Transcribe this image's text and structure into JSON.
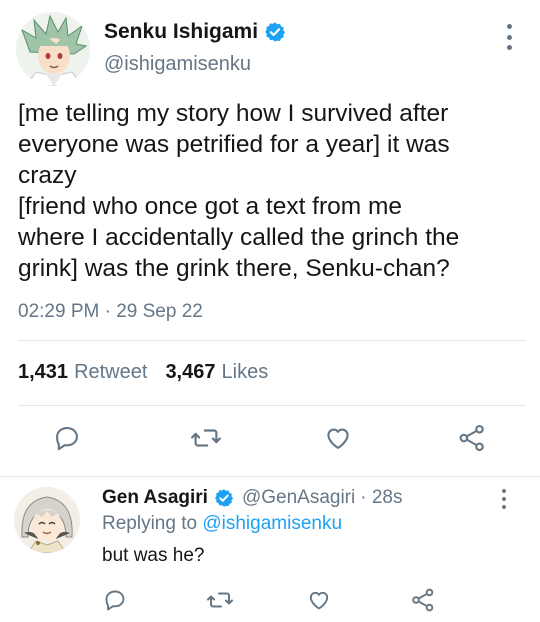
{
  "main_tweet": {
    "author": {
      "display_name": "Senku Ishigami",
      "handle": "@ishigamisenku",
      "verified": true
    },
    "text_lines": [
      "[me telling my story how I survived after",
      "everyone was petrified for a year] it was",
      "crazy",
      "[friend who once got a text from me",
      "where I accidentally called the grinch the",
      "grink] was the grink there, Senku-chan?"
    ],
    "timestamp": "02:29 PM · 29 Sep 22",
    "stats": {
      "retweets_count": "1,431",
      "retweets_label": "Retweet",
      "likes_count": "3,467",
      "likes_label": "Likes"
    },
    "actions": [
      "reply-icon",
      "retweet-icon",
      "like-icon",
      "share-icon"
    ]
  },
  "reply_tweet": {
    "author": {
      "display_name": "Gen Asagiri",
      "handle": "@GenAsagiri",
      "verified": true
    },
    "time": "· 28s",
    "replying_prefix": "Replying to",
    "replying_to": "@ishigamisenku",
    "text": "but was he?",
    "actions": [
      "reply-icon",
      "retweet-icon",
      "like-icon",
      "share-icon"
    ]
  },
  "colors": {
    "accent": "#1da1f2",
    "text_primary": "#14171a",
    "text_secondary": "#657786",
    "divider": "#e1e8ed"
  }
}
